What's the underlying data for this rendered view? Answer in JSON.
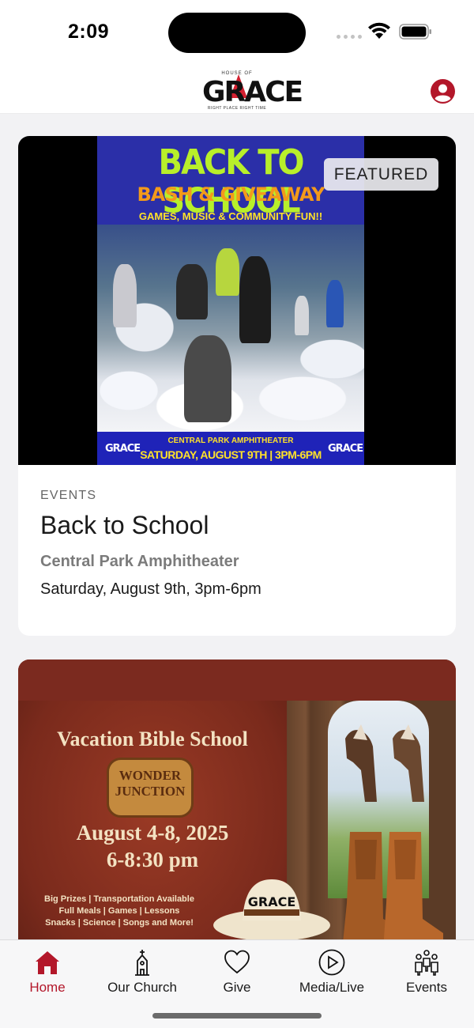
{
  "status_bar": {
    "time": "2:09"
  },
  "header": {
    "logo_word": "GRACE",
    "logo_small_text": "HOUSE OF",
    "logo_tagline": "RIGHT PLACE RIGHT TIME",
    "profile_icon": "user-circle-icon",
    "brand_color": "#b3172a"
  },
  "feed": {
    "featured_badge": "FEATURED",
    "cards": [
      {
        "category": "EVENTS",
        "title": "Back to School",
        "location": "Central Park Amphitheater",
        "date": "Saturday, August 9th, 3pm-6pm",
        "poster": {
          "headline": "BACK TO SCHOOL",
          "subheadline": "BASH & GIVEAWAY",
          "tagline": "GAMES, MUSIC & COMMUNITY FUN!!",
          "venue": "CENTRAL PARK AMPHITHEATER",
          "datetime": "SATURDAY, AUGUST 9TH | 3PM-6PM",
          "mini_logo": "GRACE"
        }
      },
      {
        "poster": {
          "title": "Vacation Bible School",
          "theme": "WONDER JUNCTION",
          "dates": "August 4-8, 2025",
          "time": "6-8:30 pm",
          "details_line1": "Big Prizes | Transportation Available",
          "details_line2": "Full Meals | Games | Lessons",
          "details_line3": "Snacks | Science | Songs and More!",
          "hat_logo": "GRACE"
        }
      }
    ]
  },
  "tab_bar": {
    "tabs": [
      {
        "label": "Home",
        "icon": "home-icon",
        "active": true
      },
      {
        "label": "Our Church",
        "icon": "church-icon",
        "active": false
      },
      {
        "label": "Give",
        "icon": "heart-icon",
        "active": false
      },
      {
        "label": "Media/Live",
        "icon": "play-circle-icon",
        "active": false
      },
      {
        "label": "Events",
        "icon": "people-icon",
        "active": false
      }
    ]
  }
}
